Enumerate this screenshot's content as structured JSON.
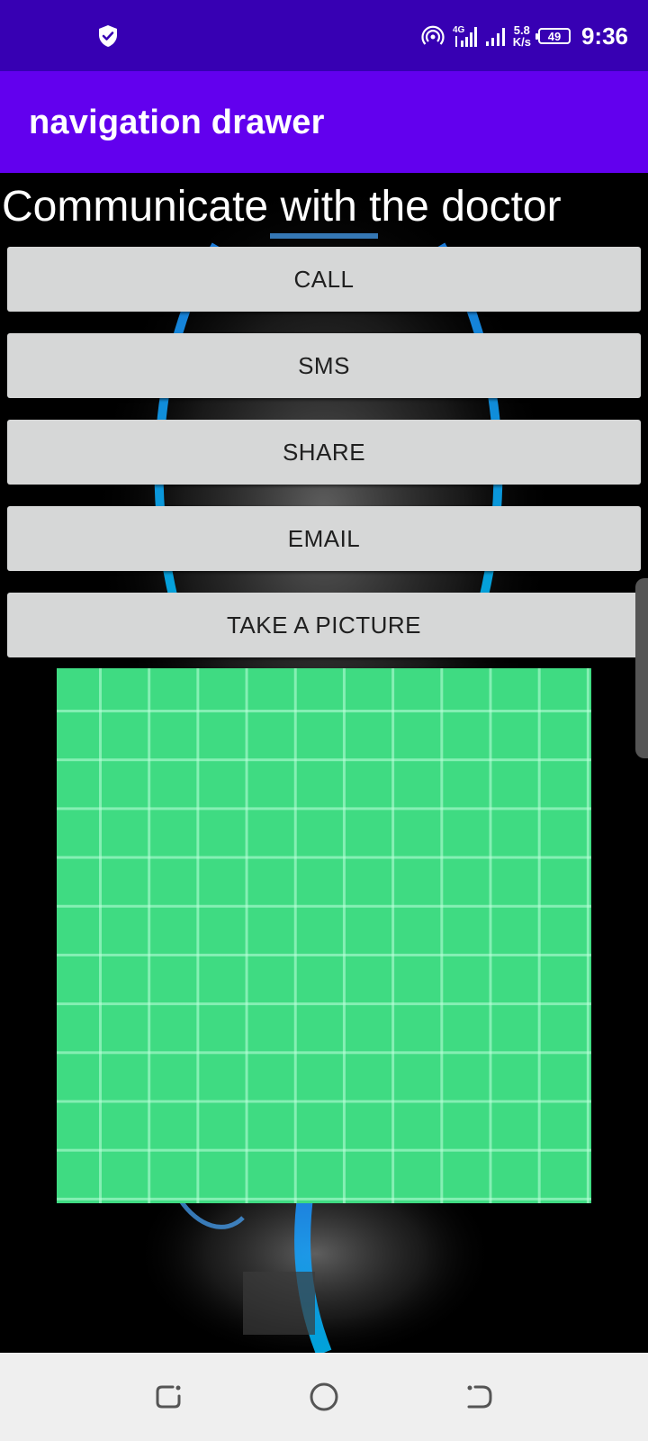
{
  "status_bar": {
    "time": "9:36",
    "battery": "49",
    "net_speed_value": "5.8",
    "net_speed_unit": "K/s",
    "network_type": "4G",
    "icons": [
      "shield-icon",
      "hotspot-icon",
      "signal-4g-icon",
      "signal-icon",
      "battery-icon"
    ],
    "background_color": "#3700b3"
  },
  "app_bar": {
    "title": "navigation drawer",
    "background_color": "#6200ee"
  },
  "main": {
    "heading": "Communicate with the doctor",
    "buttons": [
      {
        "label": "CALL"
      },
      {
        "label": "SMS"
      },
      {
        "label": "SHARE"
      },
      {
        "label": "EMAIL"
      },
      {
        "label": "TAKE A PICTURE"
      }
    ],
    "image_color": "#3fdb82"
  },
  "nav_bar": {
    "buttons": [
      "recents-icon",
      "home-icon",
      "back-icon"
    ]
  }
}
